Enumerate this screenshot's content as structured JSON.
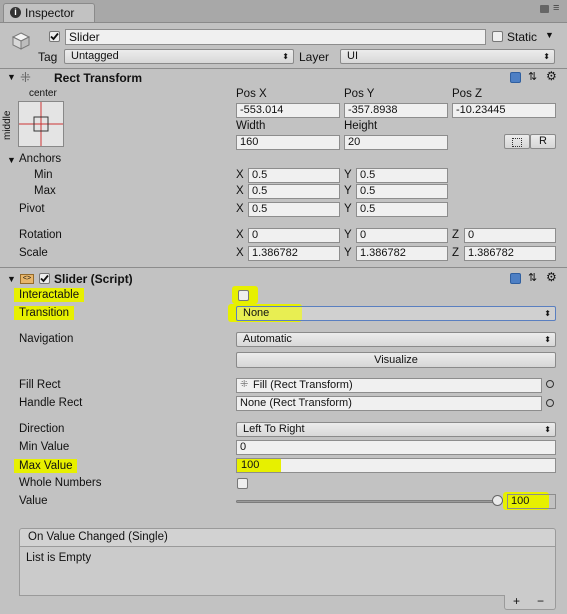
{
  "tab": {
    "title": "Inspector"
  },
  "header": {
    "object_name": "Slider",
    "static_label": "Static",
    "tag_label": "Tag",
    "tag_value": "Untagged",
    "layer_label": "Layer",
    "layer_value": "UI"
  },
  "rect_transform": {
    "title": "Rect Transform",
    "anchor_preset": {
      "top": "center",
      "side": "middle"
    },
    "pos_x_label": "Pos X",
    "pos_y_label": "Pos Y",
    "pos_z_label": "Pos Z",
    "pos_x": "-553.014",
    "pos_y": "-357.8938",
    "pos_z": "-10.23445",
    "width_label": "Width",
    "height_label": "Height",
    "width": "160",
    "height": "20",
    "raw_button": "R",
    "anchors_label": "Anchors",
    "min_label": "Min",
    "max_label": "Max",
    "anchor_min_x": "0.5",
    "anchor_min_y": "0.5",
    "anchor_max_x": "0.5",
    "anchor_max_y": "0.5",
    "pivot_label": "Pivot",
    "pivot_x": "0.5",
    "pivot_y": "0.5",
    "rotation_label": "Rotation",
    "rotation_x": "0",
    "rotation_y": "0",
    "rotation_z": "0",
    "scale_label": "Scale",
    "scale_x": "1.386782",
    "scale_y": "1.386782",
    "scale_z": "1.386782",
    "axis_x": "X",
    "axis_y": "Y",
    "axis_z": "Z"
  },
  "slider_script": {
    "title": "Slider (Script)",
    "interactable_label": "Interactable",
    "transition_label": "Transition",
    "transition_value": "None",
    "navigation_label": "Navigation",
    "navigation_value": "Automatic",
    "visualize_button": "Visualize",
    "fill_rect_label": "Fill Rect",
    "fill_rect_value": "Fill (Rect Transform)",
    "handle_rect_label": "Handle Rect",
    "handle_rect_value": "None (Rect Transform)",
    "direction_label": "Direction",
    "direction_value": "Left To Right",
    "min_value_label": "Min Value",
    "min_value": "0",
    "max_value_label": "Max Value",
    "max_value": "100",
    "whole_numbers_label": "Whole Numbers",
    "value_label": "Value",
    "value": "100",
    "value_fraction": 1.0
  },
  "event": {
    "title": "On Value Changed (Single)",
    "empty_text": "List is Empty",
    "add_button": "+",
    "remove_button": "−"
  },
  "colors": {
    "highlight": "#e7f000",
    "panel": "#c2c2c2",
    "accent": "#4d7fc4"
  }
}
